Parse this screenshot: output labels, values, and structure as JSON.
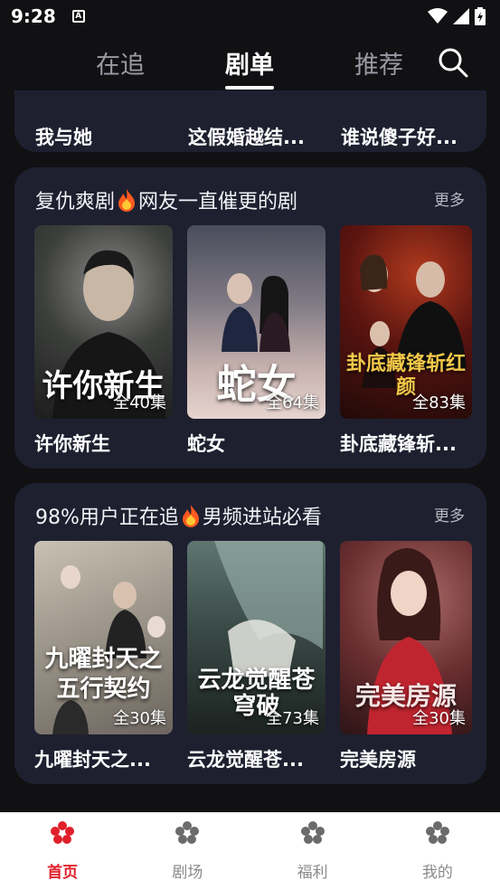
{
  "status": {
    "time": "9:28",
    "notification_glyph": "A"
  },
  "tabs": [
    {
      "label": "在追",
      "active": false
    },
    {
      "label": "剧单",
      "active": true
    },
    {
      "label": "推荐",
      "active": false
    }
  ],
  "peek_row": [
    "我与她",
    "这假婚越结...",
    "谁说傻子好..."
  ],
  "sections": [
    {
      "title_a": "复仇爽剧",
      "title_b": "网友一直催更的剧",
      "more": "更多",
      "items": [
        {
          "title": "许你新生",
          "episodes": "全40集",
          "art": "许你新生"
        },
        {
          "title": "蛇女",
          "episodes": "全64集",
          "art": "蛇女"
        },
        {
          "title": "卦底藏锋斩...",
          "episodes": "全83集",
          "art": "卦底藏锋斩红颜"
        }
      ]
    },
    {
      "title_a": "98%用户正在追",
      "title_b": "男频进站必看",
      "more": "更多",
      "items": [
        {
          "title": "九曜封天之...",
          "episodes": "全30集",
          "art": "九曜封天之五行契约"
        },
        {
          "title": "云龙觉醒苍...",
          "episodes": "全73集",
          "art": "云龙觉醒苍穹破"
        },
        {
          "title": "完美房源",
          "episodes": "全30集",
          "art": "完美房源"
        }
      ]
    }
  ],
  "nav": [
    {
      "label": "首页",
      "active": true
    },
    {
      "label": "剧场",
      "active": false
    },
    {
      "label": "福利",
      "active": false
    },
    {
      "label": "我的",
      "active": false
    }
  ],
  "colors": {
    "accent": "#e0202a",
    "card_bg": "#1e2030",
    "page_bg": "#111114"
  }
}
